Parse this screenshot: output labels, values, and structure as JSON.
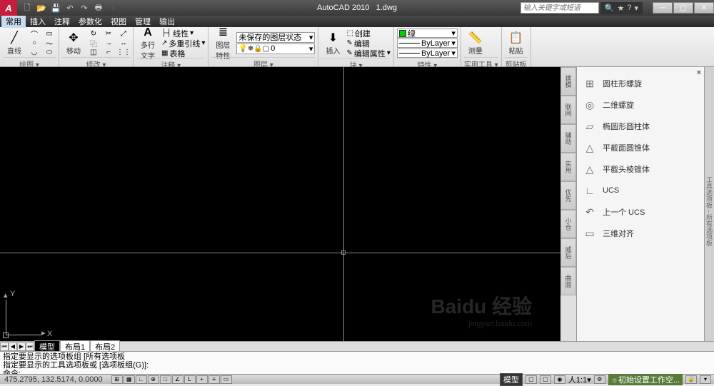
{
  "title": {
    "app": "AutoCAD 2010",
    "file": "1.dwg"
  },
  "search": {
    "placeholder": "输入关键字或短语"
  },
  "menu": {
    "items": [
      "常用",
      "插入",
      "注释",
      "参数化",
      "视图",
      "管理",
      "输出"
    ]
  },
  "ribbon": {
    "draw": {
      "title": "绘图 ▾",
      "line": "直线"
    },
    "modify": {
      "title": "修改 ▾",
      "move": "移动"
    },
    "annot": {
      "title": "注释 ▾",
      "text": "多行\n文字",
      "r1": "线性",
      "r2": "多重引线",
      "r3": "表格"
    },
    "layers": {
      "title": "图层 ▾",
      "state": "未保存的图层状态",
      "current": "0",
      "btn": "图层\n特性"
    },
    "block": {
      "title": "块 ▾",
      "insert": "插入",
      "r1": "创建",
      "r2": "编辑",
      "r3": "编辑属性"
    },
    "props": {
      "title": "特性 ▾",
      "color": "绿",
      "bylayer": "ByLayer"
    },
    "util": {
      "title": "实用工具 ▾",
      "measure": "测量"
    },
    "clip": {
      "title": "剪贴板",
      "paste": "粘贴"
    }
  },
  "palette": {
    "items": [
      {
        "icon": "⊞",
        "label": "圆柱形螺旋"
      },
      {
        "icon": "◎",
        "label": "二维螺旋"
      },
      {
        "icon": "▱",
        "label": "椭圆形圆柱体"
      },
      {
        "icon": "△",
        "label": "平截面圆锥体"
      },
      {
        "icon": "△",
        "label": "平截头棱锥体"
      },
      {
        "icon": "∟",
        "label": "UCS"
      },
      {
        "icon": "↶",
        "label": "上一个 UCS"
      },
      {
        "icon": "▭",
        "label": "三维对齐"
      }
    ]
  },
  "right_strip": "工具选项板 - 所有选项板",
  "layout_tabs": [
    "模型",
    "布局1",
    "布局2"
  ],
  "cmd": {
    "l1": "指定要显示的选项板组 [所有选项板",
    "l2": "指定要显示的工具选项板或 [选项板组(G)]:",
    "l3": "命令:"
  },
  "status": {
    "coords": "475.2795, 132.5174, 0.0000",
    "model": "模型",
    "ratio": "人1:1▾",
    "ws": "初始设置工作空..."
  },
  "watermark": {
    "main": "Baidu 经验",
    "sub": "jingyan.baidu.com"
  },
  "ucs": {
    "x": "X",
    "y": "Y"
  }
}
